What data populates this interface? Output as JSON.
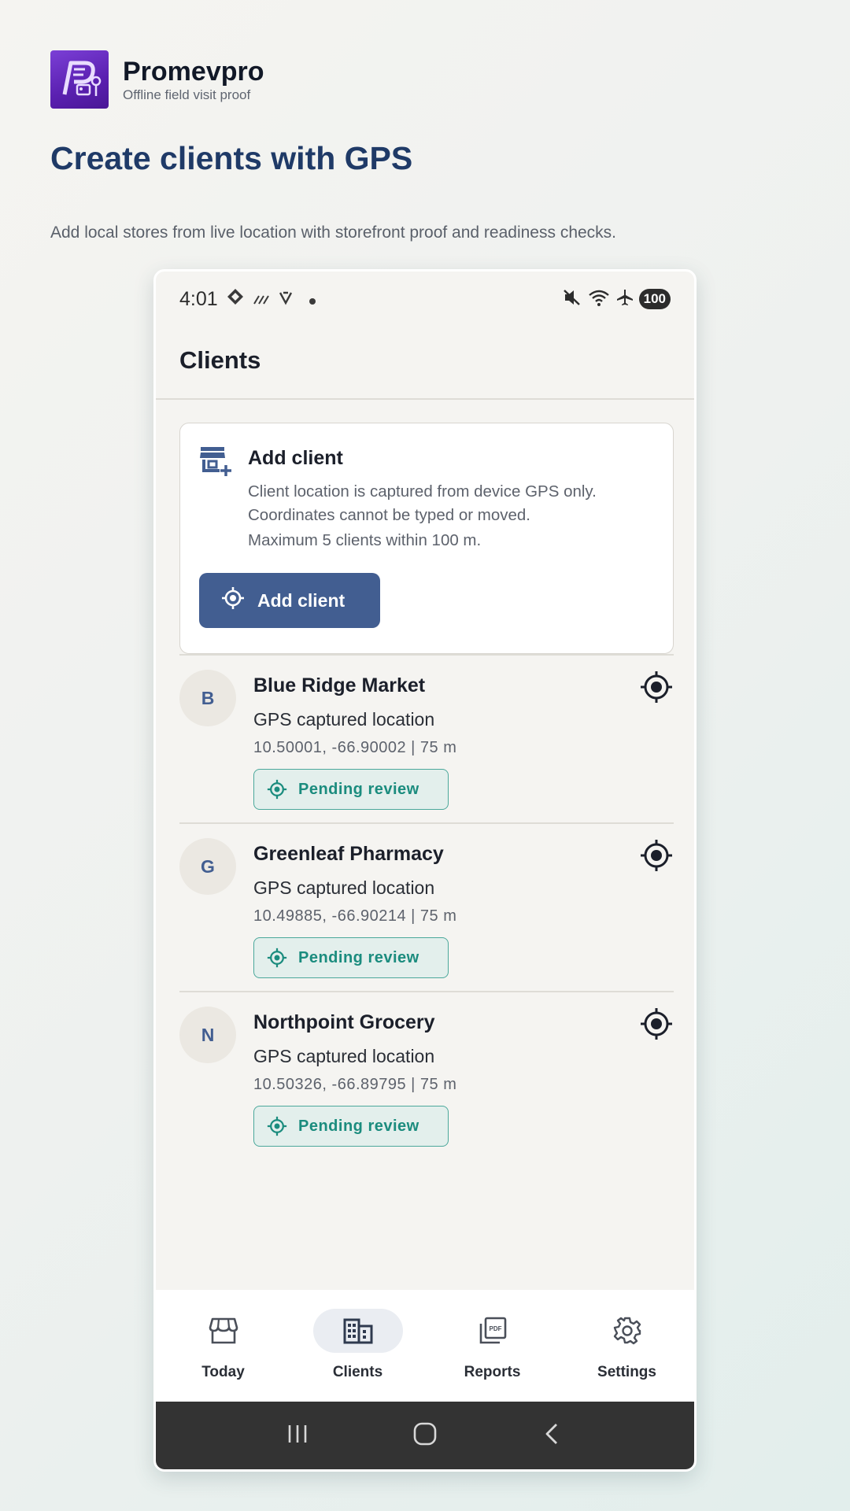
{
  "brand": {
    "name": "Promevpro",
    "tagline": "Offline field visit proof"
  },
  "hero": {
    "title": "Create clients with GPS",
    "subtitle": "Add local stores from live location with storefront proof and readiness checks."
  },
  "status_bar": {
    "time": "4:01",
    "battery": "100",
    "icons": [
      "diamond-icon",
      "signal-lines-icon",
      "v-icon",
      "dot-icon",
      "mute-icon",
      "wifi-icon",
      "airplane-icon"
    ]
  },
  "screen": {
    "title": "Clients"
  },
  "add_card": {
    "icon": "store-add-icon",
    "title": "Add client",
    "line1": "Client location is captured from device GPS only. Coordinates cannot be typed or moved.",
    "line2": "Maximum 5 clients within 100 m.",
    "button_label": "Add client"
  },
  "clients": [
    {
      "initial": "B",
      "name": "Blue Ridge Market",
      "location_label": "GPS captured location",
      "coords": "10.50001, -66.90002 | 75 m",
      "status": "Pending review"
    },
    {
      "initial": "G",
      "name": "Greenleaf Pharmacy",
      "location_label": "GPS captured location",
      "coords": "10.49885, -66.90214 | 75 m",
      "status": "Pending review"
    },
    {
      "initial": "N",
      "name": "Northpoint Grocery",
      "location_label": "GPS captured location",
      "coords": "10.50326, -66.89795 | 75 m",
      "status": "Pending review"
    }
  ],
  "nav": {
    "items": [
      {
        "label": "Today",
        "icon": "storefront-icon",
        "active": false
      },
      {
        "label": "Clients",
        "icon": "building-icon",
        "active": true
      },
      {
        "label": "Reports",
        "icon": "pdf-icon",
        "active": false
      },
      {
        "label": "Settings",
        "icon": "gear-icon",
        "active": false
      }
    ]
  },
  "colors": {
    "accent": "#425e91",
    "title": "#1f3a67",
    "status_teal": "#1b8c7e",
    "logo_purple": "#6a2fc4"
  }
}
